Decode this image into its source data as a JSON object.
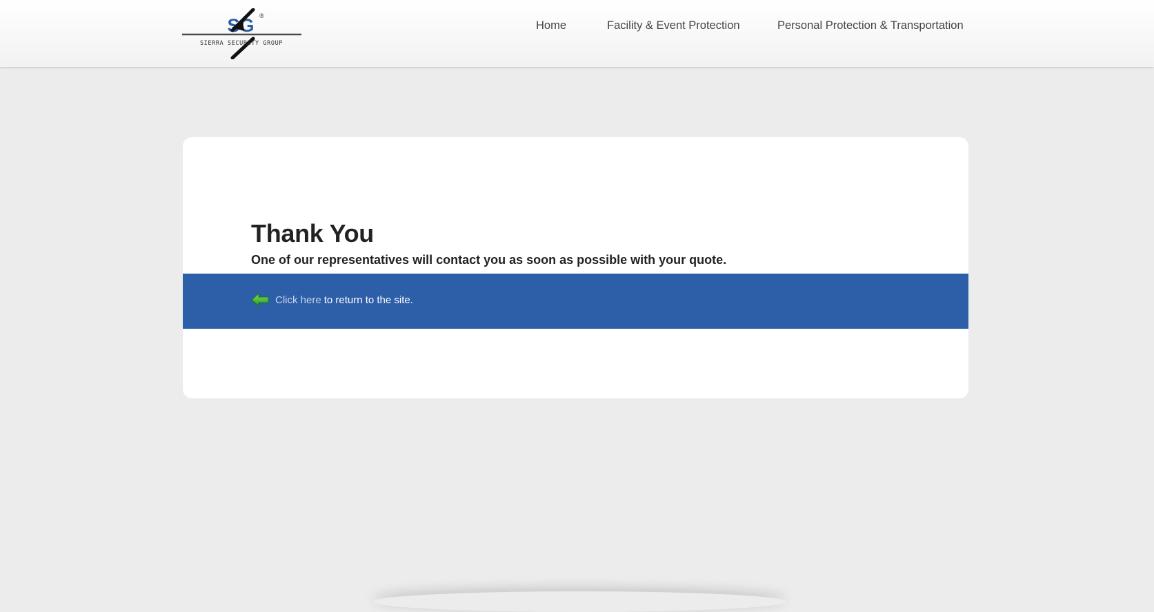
{
  "header": {
    "logo_text": "SIERRA SECURITY GROUP",
    "logo_initials": "SG",
    "logo_mark": "®",
    "nav": [
      {
        "label": "Home"
      },
      {
        "label": "Facility & Event Protection"
      },
      {
        "label": "Personal Protection & Transportation"
      }
    ]
  },
  "main": {
    "title": "Thank You",
    "subtitle": "One of our representatives will contact you as soon as possible with your quote.",
    "back": {
      "icon": "arrow-left-icon",
      "link_label": "Click here",
      "suffix": "to return to the site."
    }
  },
  "colors": {
    "background": "#edeced",
    "band": "#2d5ea8",
    "logo_blue": "#2b5fa8",
    "arrow_green": "#3aa82a"
  }
}
